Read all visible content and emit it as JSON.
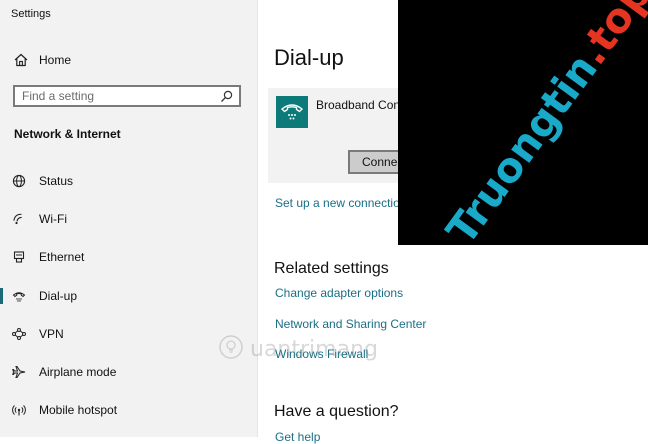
{
  "app": {
    "title": "Settings"
  },
  "sidebar": {
    "home_label": "Home",
    "search_placeholder": "Find a setting",
    "section_title": "Network & Internet",
    "items": [
      {
        "label": "Status",
        "icon": "globe-icon"
      },
      {
        "label": "Wi-Fi",
        "icon": "wifi-icon"
      },
      {
        "label": "Ethernet",
        "icon": "ethernet-icon"
      },
      {
        "label": "Dial-up",
        "icon": "dialup-icon",
        "selected": true
      },
      {
        "label": "VPN",
        "icon": "vpn-icon"
      },
      {
        "label": "Airplane mode",
        "icon": "airplane-icon"
      },
      {
        "label": "Mobile hotspot",
        "icon": "hotspot-icon"
      }
    ]
  },
  "main": {
    "title": "Dial-up",
    "connection": {
      "name": "Broadband Conn",
      "button_label": "Connec"
    },
    "setup_link": "Set up a new connection",
    "related": {
      "heading": "Related settings",
      "links": [
        "Change adapter options",
        "Network and Sharing Center",
        "Windows Firewall"
      ]
    },
    "question": {
      "heading": "Have a question?",
      "link": "Get help"
    }
  },
  "watermark": {
    "text_part1": "Truongtin",
    "text_part2": ".top",
    "secondary": "uantrimang"
  },
  "colors": {
    "accent": "#1c6a78",
    "link": "#1a6f86",
    "tile": "#0b7a78",
    "sidebar_bg": "#f2f2f2"
  }
}
